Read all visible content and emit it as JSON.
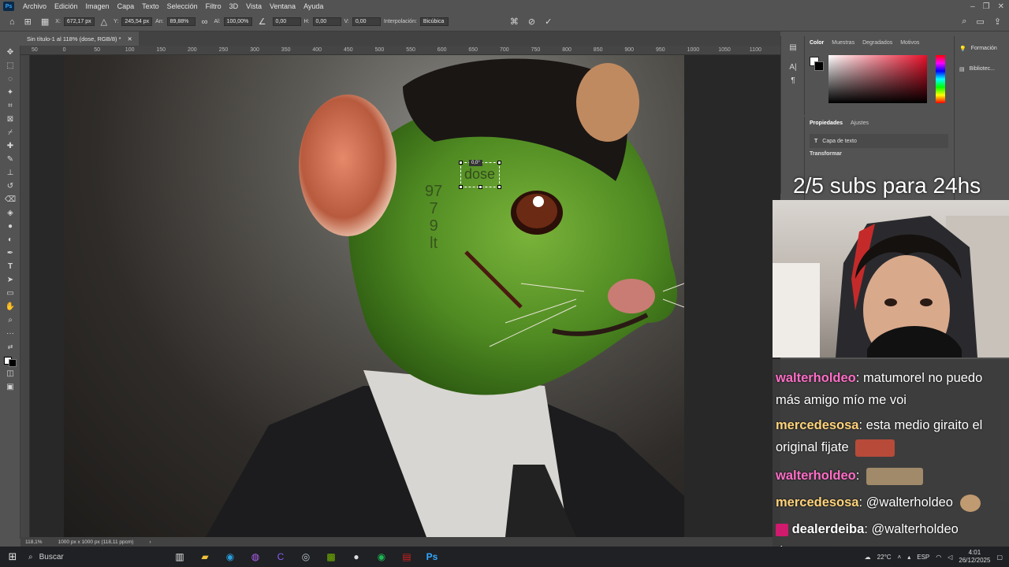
{
  "menubar": {
    "items": [
      "Archivo",
      "Edición",
      "Imagen",
      "Capa",
      "Texto",
      "Selección",
      "Filtro",
      "3D",
      "Vista",
      "Ventana",
      "Ayuda"
    ]
  },
  "options": {
    "x_label": "X:",
    "x_value": "672,17 px",
    "y_label": "Y:",
    "y_value": "245,54 px",
    "w_label": "An:",
    "w_value": "89,88%",
    "h_label": "Al:",
    "h_value": "100,00%",
    "angle_value": "0,00",
    "hskew_label": "H:",
    "hskew_value": "0,00",
    "vskew_label": "V:",
    "vskew_value": "0,00",
    "interp_label": "Interpolación:",
    "interp_value": "Bicúbica"
  },
  "document": {
    "tab_title": "Sin título-1 al 118% (dose, RGB/8) *",
    "text_layer": "dose",
    "rotate_tooltip": "0,0°",
    "vertical_text": [
      "97",
      "7",
      "9",
      "lt"
    ]
  },
  "rulers": {
    "top": [
      "50",
      "0",
      "50",
      "100",
      "150",
      "200",
      "250",
      "300",
      "350",
      "400",
      "450",
      "500",
      "550",
      "600",
      "650",
      "700",
      "750",
      "800",
      "850",
      "900",
      "950",
      "1000",
      "1050",
      "1100"
    ]
  },
  "statusbar": {
    "zoom": "118,1%",
    "doc_info": "1000 px x 1000 px (118,11 ppcm)"
  },
  "color_panel": {
    "tabs": [
      "Color",
      "Muestras",
      "Degradados",
      "Motivos"
    ]
  },
  "props_panel": {
    "tabs": [
      "Propiedades",
      "Ajustes"
    ],
    "layer_type": "Capa de texto",
    "section": "Transformar"
  },
  "side_panel": {
    "items": [
      "Formación",
      "Bibliotec..."
    ]
  },
  "overlay": {
    "subs": "2/5 subs para 24hs"
  },
  "chat": {
    "messages": [
      {
        "user": "walterholdeo",
        "color": "#ff6ec7",
        "text": "matumorel no puedo más amigo mío me voi"
      },
      {
        "user": "mercedesosa",
        "color": "#ffd37a",
        "text": "esta medio giraito el original fijate"
      },
      {
        "user": "walterholdeo",
        "color": "#ff6ec7",
        "text": ""
      },
      {
        "user": "mercedesosa",
        "color": "#ffd37a",
        "text": "@walterholdeo"
      },
      {
        "user": "dealerdeiba",
        "color": "#ffffff",
        "text": "@walterholdeo descansa"
      }
    ]
  },
  "taskbar": {
    "search_placeholder": "Buscar",
    "temperature": "22°C",
    "language": "ESP",
    "time": "4:01",
    "date": "26/12/2025"
  }
}
